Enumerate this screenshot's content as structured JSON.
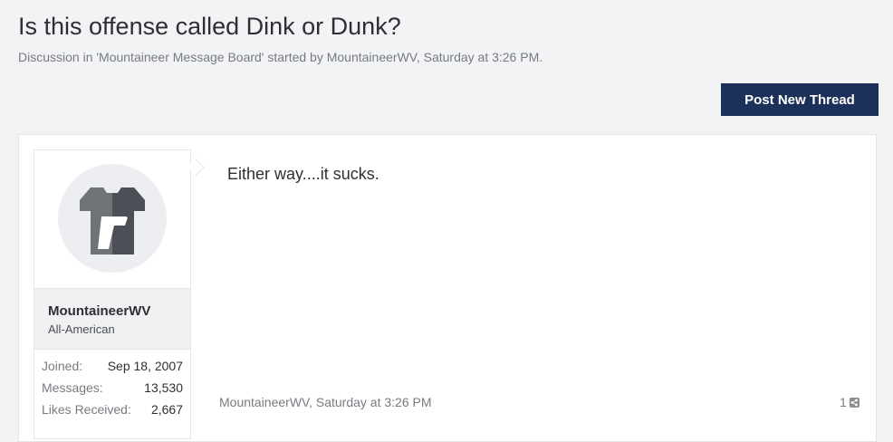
{
  "thread": {
    "title": "Is this offense called Dink or Dunk?",
    "subtitle": "Discussion in 'Mountaineer Message Board' started by MountaineerWV, Saturday at 3:26 PM."
  },
  "actions": {
    "post_new_thread": "Post New Thread"
  },
  "post": {
    "author": {
      "name": "MountaineerWV",
      "title": "All-American",
      "avatar_icon": "shirt-logo-icon",
      "stats": [
        {
          "label": "Joined:",
          "value": "Sep 18, 2007"
        },
        {
          "label": "Messages:",
          "value": "13,530"
        },
        {
          "label": "Likes Received:",
          "value": "2,667"
        }
      ]
    },
    "message": "Either way....it sucks.",
    "meta": "MountaineerWV, Saturday at 3:26 PM",
    "number": "1",
    "share_icon": "share-icon"
  },
  "colors": {
    "accent": "#1b3159",
    "background": "#f2f3f5"
  }
}
